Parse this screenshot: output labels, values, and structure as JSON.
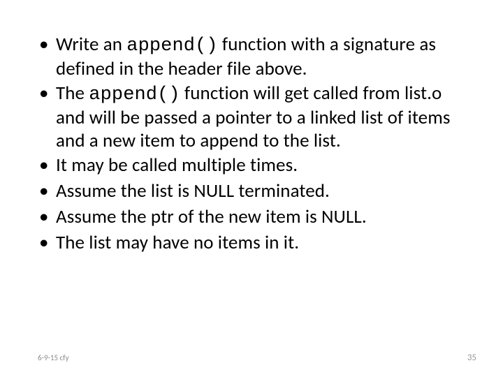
{
  "bullets": [
    {
      "pre": "Write an ",
      "code": "append()",
      "post": "  function with a signature as defined in the header file above."
    },
    {
      "pre": "The ",
      "code": "append()",
      "post": " function will get called from list.o and will be passed a pointer to a linked list of items and a new item to append to the list."
    },
    {
      "pre": "It may be called multiple times.",
      "code": "",
      "post": ""
    },
    {
      "pre": "Assume the list is NULL terminated.",
      "code": "",
      "post": ""
    },
    {
      "pre": "Assume the ptr of the new item is NULL.",
      "code": "",
      "post": ""
    },
    {
      "pre": "The list may have no items in it.",
      "code": "",
      "post": ""
    }
  ],
  "footer": {
    "left": "6-9-15 cfy",
    "pagenum": "35"
  }
}
